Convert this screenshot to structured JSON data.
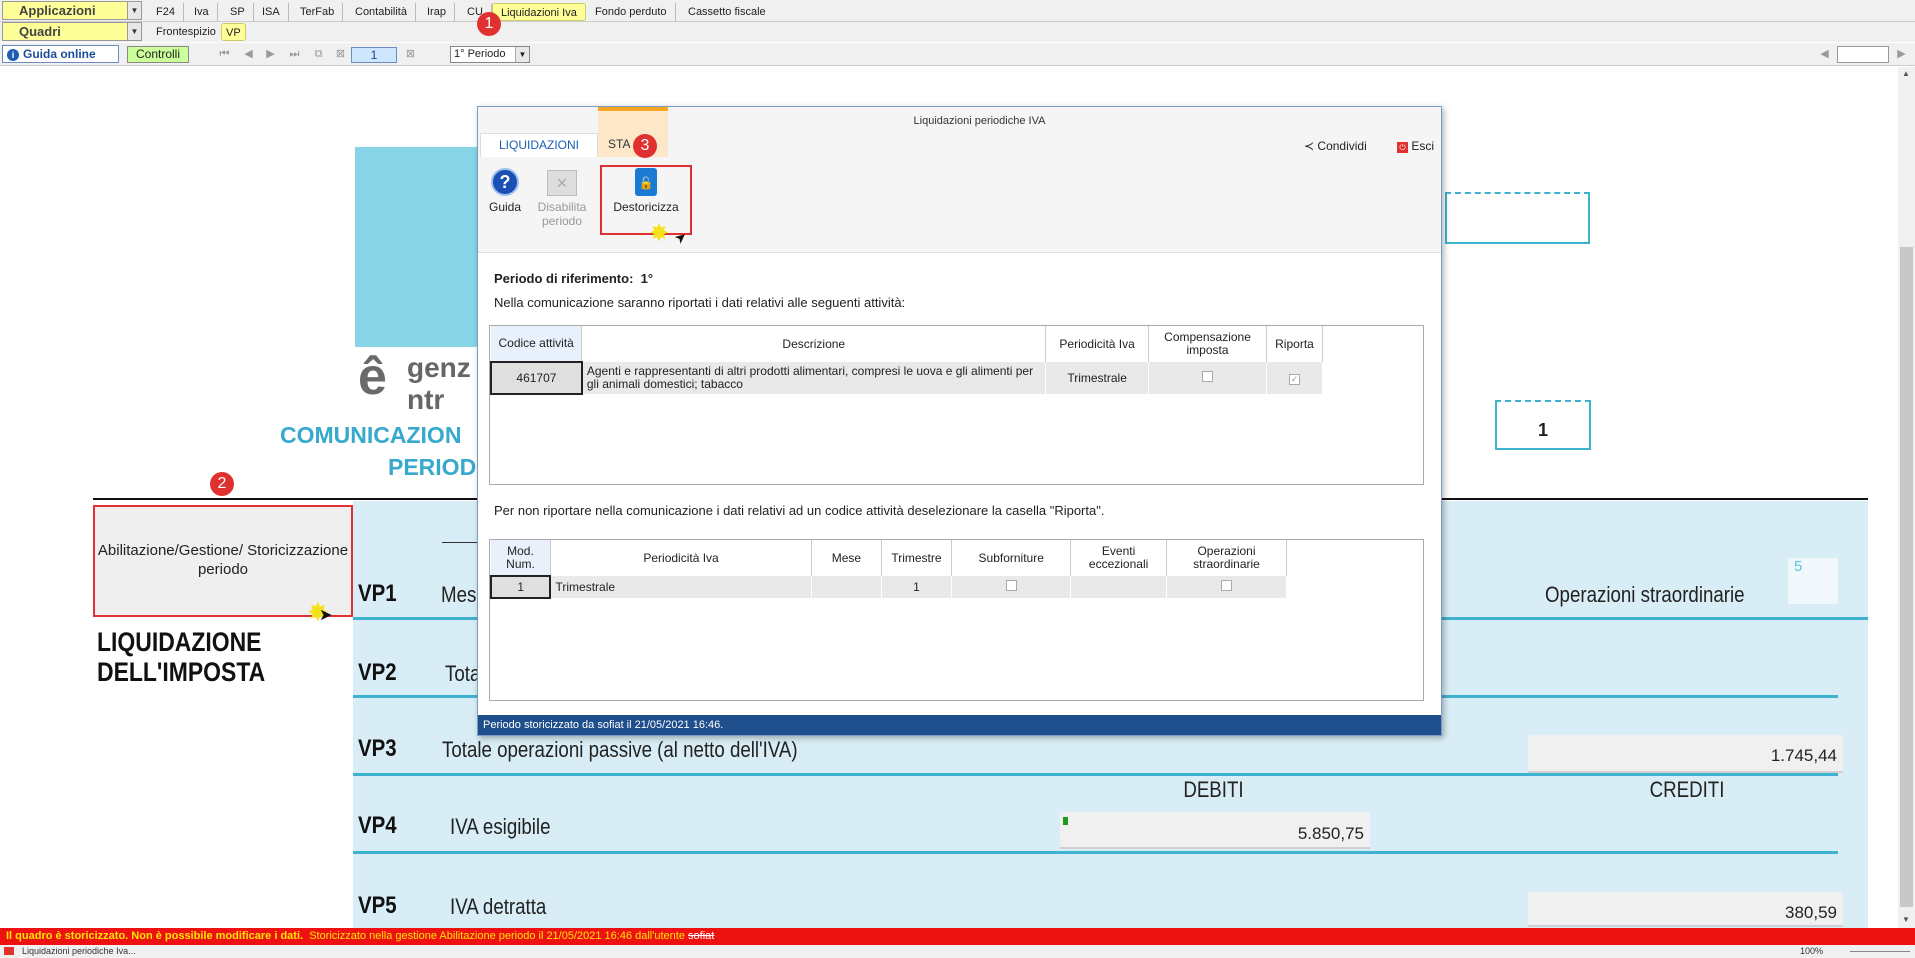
{
  "toolbar": {
    "app_combo": "Applicazioni",
    "quadri_combo": "Quadri",
    "tabs": [
      "F24",
      "Iva",
      "SP",
      "ISA",
      "TerFab",
      "Contabilità",
      "Irap",
      "CU",
      "Liquidazioni Iva",
      "Fondo perduto",
      "Cassetto fiscale"
    ],
    "subtabs": [
      "Frontespizio",
      "VP"
    ],
    "guide_button": "Guida online",
    "controls_button": "Controlli",
    "page_number": "1",
    "period_select": "1° Periodo"
  },
  "callouts": {
    "one": "1",
    "two": "2",
    "three": "3"
  },
  "document": {
    "header_box_value": "1",
    "logo_text_1": "genz",
    "logo_text_2": "ntr",
    "title_1": "COMUNICAZION",
    "title_2": "PERIOD",
    "side_title": "LIQUIDAZIONE DELL'IMPOSTA",
    "abilitazione_button": "Abilitazione/Gestione/ Storicizzazione periodo",
    "vp1": {
      "code": "VP1",
      "label": "Mes",
      "right_label": "Operazioni straordinarie",
      "right_box": "5"
    },
    "vp2": {
      "code": "VP2",
      "label": "Tota"
    },
    "vp3": {
      "code": "VP3",
      "label": "Totale operazioni passive (al netto dell'IVA)",
      "value": "1.745,44"
    },
    "debiti": "DEBITI",
    "crediti": "CREDITI",
    "vp4": {
      "code": "VP4",
      "label": "IVA esigibile",
      "value": "5.850,75"
    },
    "vp5": {
      "code": "VP5",
      "label": "IVA detratta",
      "value": "380,59"
    }
  },
  "dialog": {
    "title": "Liquidazioni periodiche IVA",
    "tabs": [
      "LIQUIDAZIONI",
      "STA"
    ],
    "share": "Condividi",
    "exit": "Esci",
    "buttons": {
      "guida": "Guida",
      "disabilita": "Disabilita periodo",
      "destoricizza": "Destoricizza"
    },
    "periodo_label": "Periodo di riferimento:",
    "periodo_value": "1°",
    "intro": "Nella comunicazione saranno riportati i dati relativi alle seguenti attività:",
    "activities": {
      "headers": [
        "Codice attività",
        "Descrizione",
        "Periodicità Iva",
        "Compensazione imposta",
        "Riporta"
      ],
      "rows": [
        {
          "code": "461707",
          "description": "Agenti e rappresentanti di altri prodotti alimentari, compresi le uova e gli alimenti per gli animali domestici; tabacco",
          "periodicity": "Trimestrale",
          "compensazione": false,
          "riporta": true
        }
      ]
    },
    "note": "Per non riportare nella comunicazione i dati relativi ad un codice attività deselezionare la casella \"Riporta\".",
    "modules": {
      "headers": [
        "Mod. Num.",
        "Periodicità Iva",
        "Mese",
        "Trimestre",
        "Subforniture",
        "Eventi eccezionali",
        "Operazioni straordinarie"
      ],
      "rows": [
        {
          "num": "1",
          "periodicity": "Trimestrale",
          "mese": "",
          "trimestre": "1",
          "subforniture": false,
          "eventi": "",
          "operazioni": false
        }
      ]
    },
    "status": "Periodo storicizzato da sofiat il 21/05/2021 16:46."
  },
  "statusbar": {
    "message": "Il quadro è storicizzato. Non è possibile modificare i dati.",
    "detail": "Storicizzato nella gestione Abilitazione periodo il 21/05/2021 16:46 dall'utente",
    "user": "sofiat"
  },
  "taskbar": {
    "window": "Liquidazioni periodiche Iva...",
    "zoom": "100%"
  },
  "colors": {
    "accent_yellow": "#ffff99",
    "status_red": "#ee1111",
    "doc_cyan": "#3fb2cf",
    "dialog_status": "#1f4e8c"
  }
}
